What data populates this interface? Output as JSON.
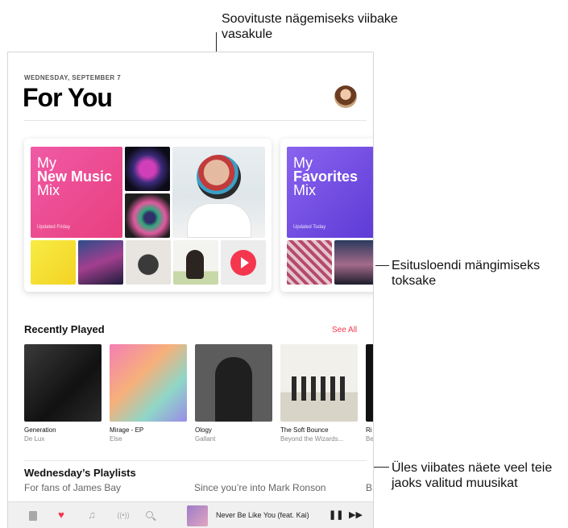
{
  "callouts": {
    "top": "Soovituste nägemiseks viibake vasakule",
    "right_middle": "Esitusloendi mängimiseks toksake",
    "right_bottom": "Üles viibates näete veel teie jaoks valitud muusikat"
  },
  "header": {
    "date": "WEDNESDAY, SEPTEMBER 7",
    "title": "For You"
  },
  "mixes": [
    {
      "line1": "My",
      "line2": "New Music",
      "line3": "Mix",
      "updated": "Updated Friday"
    },
    {
      "line1": "My",
      "line2": "Favorites",
      "line3": "Mix",
      "updated": "Updated Today"
    }
  ],
  "recently_played": {
    "heading": "Recently Played",
    "see_all": "See All",
    "items": [
      {
        "title": "Generation",
        "artist": "De Lux"
      },
      {
        "title": "Mirage - EP",
        "artist": "Else"
      },
      {
        "title": "Ology",
        "artist": "Gallant"
      },
      {
        "title": "The Soft Bounce",
        "artist": "Beyond the Wizards..."
      },
      {
        "title": "Ri",
        "artist": "Be"
      }
    ]
  },
  "playlists": {
    "heading": "Wednesday’s Playlists",
    "sub1": "For fans of James Bay",
    "sub2": "Since you’re into Mark Ronson",
    "sub3": "B"
  },
  "now_playing": {
    "title": "Never Be Like You (feat. Kai)",
    "pause_icon": "pause-icon",
    "next_icon": "fast-forward-icon"
  },
  "tabbar_icons": [
    "library-icon",
    "heart-icon",
    "music-note-icon",
    "radio-icon",
    "search-icon"
  ],
  "colors": {
    "accent": "#f4364f",
    "new_music_mix": "#e8458f",
    "favorites_mix": "#7b55e6"
  }
}
